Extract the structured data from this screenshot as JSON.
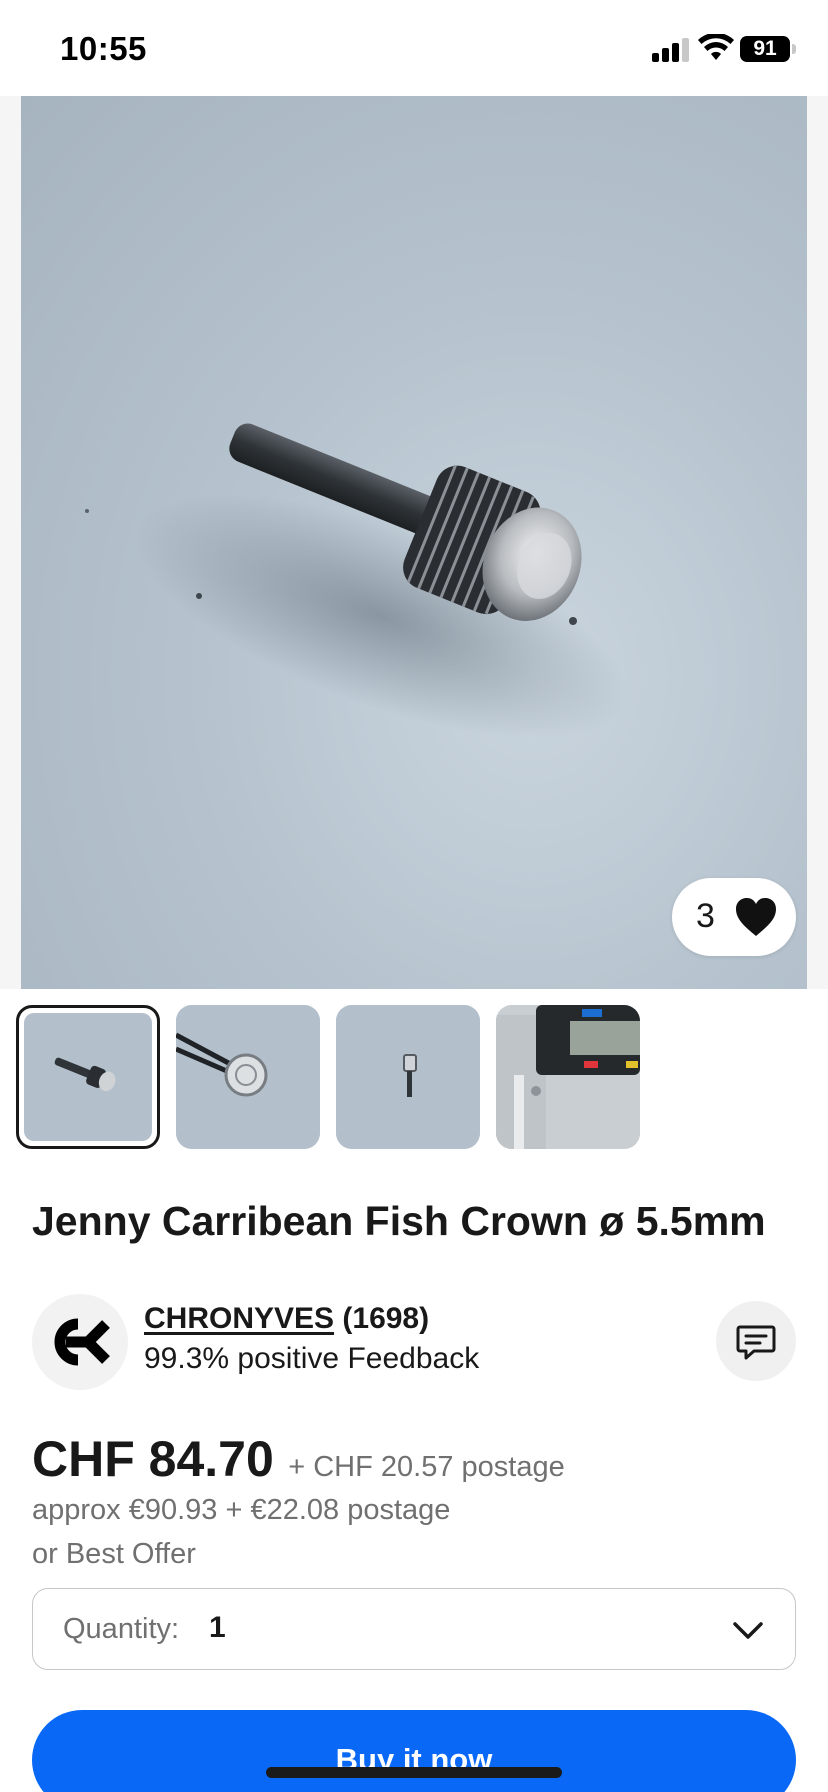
{
  "status_bar": {
    "time": "10:55",
    "battery": "91",
    "icons": [
      "signal-icon",
      "wifi-icon",
      "battery-icon"
    ]
  },
  "gallery": {
    "like_count": "3",
    "thumbnail_count": 4,
    "selected_index": 0
  },
  "listing": {
    "title": "Jenny Carribean Fish Crown ø 5.5mm"
  },
  "seller": {
    "name": "CHRONYVES",
    "feedback_count": "(1698)",
    "feedback_percent": "99.3% positive Feedback"
  },
  "pricing": {
    "price": "CHF 84.70",
    "postage": "+ CHF 20.57 postage",
    "approx": "approx €90.93 + €22.08 postage",
    "best_offer": "or Best Offer"
  },
  "quantity": {
    "label": "Quantity:",
    "value": "1"
  },
  "actions": {
    "buy_now": "Buy it now"
  },
  "colors": {
    "accent": "#0968f6",
    "text_primary": "#191919",
    "text_secondary": "#707070"
  }
}
